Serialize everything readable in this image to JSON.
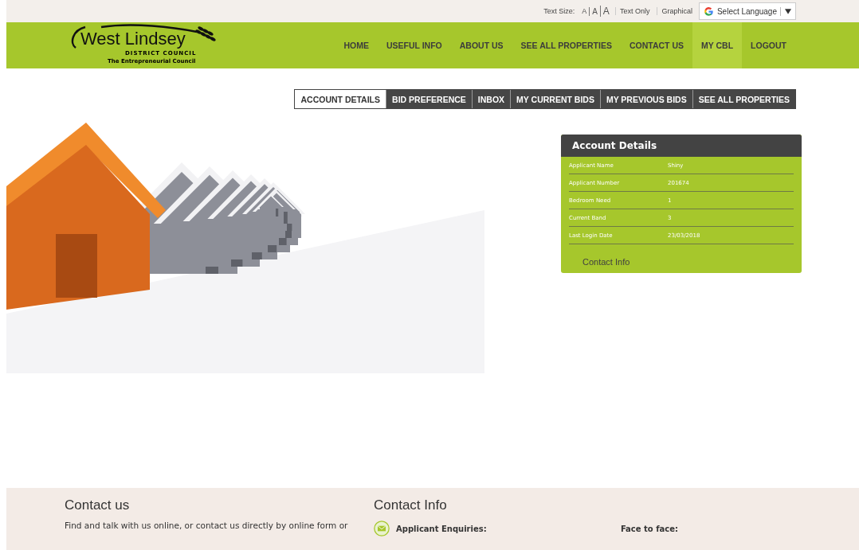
{
  "top_bar": {
    "text_size_label": "Text Size:",
    "text_sizes": [
      "A",
      "A",
      "A"
    ],
    "links": [
      "Text Only",
      "Graphical"
    ],
    "language": "Select Language"
  },
  "logo": {
    "name": "West Lindsey",
    "subtitle": "DISTRICT COUNCIL",
    "tagline": "The Entrepreneurial Council"
  },
  "nav": [
    {
      "label": "HOME",
      "selected": false
    },
    {
      "label": "USEFUL INFO",
      "selected": false
    },
    {
      "label": "ABOUT US",
      "selected": false
    },
    {
      "label": "SEE ALL PROPERTIES",
      "selected": false
    },
    {
      "label": "CONTACT US",
      "selected": false
    },
    {
      "label": "MY CBL",
      "selected": true
    },
    {
      "label": "LOGOUT",
      "selected": false
    }
  ],
  "tabs": [
    {
      "label": "ACCOUNT DETAILS",
      "selected": true
    },
    {
      "label": "BID PREFERENCE",
      "selected": false
    },
    {
      "label": "INBOX",
      "selected": false
    },
    {
      "label": "MY CURRENT BIDS",
      "selected": false
    },
    {
      "label": "MY PREVIOUS BIDS",
      "selected": false
    },
    {
      "label": "SEE ALL PROPERTIES",
      "selected": false
    }
  ],
  "account_card": {
    "title": "Account Details",
    "rows": [
      {
        "label": "Applicant Name",
        "value": "Shiny"
      },
      {
        "label": "Applicant Number",
        "value": "201674"
      },
      {
        "label": "Bedroom Need",
        "value": "1"
      },
      {
        "label": "Current Band",
        "value": "3"
      },
      {
        "label": "Last Login Date",
        "value": "23/03/2018"
      }
    ],
    "link": "Contact Info"
  },
  "footer": {
    "contact_us": {
      "title": "Contact us",
      "text": "Find and talk with us online, or contact us directly by online form or"
    },
    "contact_info": {
      "title": "Contact Info",
      "enquiries": "Applicant Enquiries:",
      "face_to_face": "Face to face:"
    }
  }
}
